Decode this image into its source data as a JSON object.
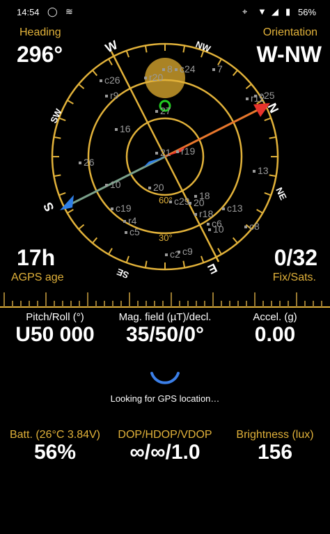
{
  "status_bar": {
    "time": "14:54",
    "battery_pct": "56%",
    "icons": [
      "whatsapp-icon",
      "signal-icon",
      "location-icon",
      "wifi-icon",
      "mobile-signal-icon",
      "battery-icon"
    ]
  },
  "top": {
    "heading_label": "Heading",
    "heading_value": "296°",
    "orientation_label": "Orientation",
    "orientation_value": "W-NW",
    "agps_value": "17h",
    "agps_label": "AGPS age",
    "fix_value": "0/32",
    "fix_label": "Fix/Sats."
  },
  "compass": {
    "directions": [
      "N",
      "NE",
      "E",
      "SE",
      "S",
      "SW",
      "W",
      "NW"
    ],
    "ring_labels": [
      "60°",
      "30°"
    ],
    "satellites": [
      {
        "id": "c26"
      },
      {
        "id": "8"
      },
      {
        "id": "c24"
      },
      {
        "id": "7"
      },
      {
        "id": "r20"
      },
      {
        "id": "r9"
      },
      {
        "id": "27"
      },
      {
        "id": "r12"
      },
      {
        "id": "c25"
      },
      {
        "id": "16"
      },
      {
        "id": "21"
      },
      {
        "id": "r19"
      },
      {
        "id": "26"
      },
      {
        "id": "13"
      },
      {
        "id": "10"
      },
      {
        "id": "20"
      },
      {
        "id": "18"
      },
      {
        "id": "c29"
      },
      {
        "id": "20"
      },
      {
        "id": "c19"
      },
      {
        "id": "c13"
      },
      {
        "id": "r18"
      },
      {
        "id": "r4"
      },
      {
        "id": "c6"
      },
      {
        "id": "c8"
      },
      {
        "id": "10"
      },
      {
        "id": "c5"
      },
      {
        "id": "c2"
      },
      {
        "id": "c9"
      }
    ],
    "colors": {
      "ring": "#e2b23a",
      "north": "#e8342c",
      "south": "#2f7fe6",
      "sun": "#c89a2a",
      "fix": "#22cc22"
    }
  },
  "stats_row1": {
    "pitch_label": "Pitch/Roll (°)",
    "pitch_value": "U50 000",
    "mag_label": "Mag. field (µT)/decl.",
    "mag_value": "35/50/0°",
    "accel_label": "Accel. (g)",
    "accel_value": "0.00"
  },
  "gps": {
    "status": "Looking for GPS location…"
  },
  "stats_row2": {
    "batt_label": "Batt. (26°C 3.84V)",
    "batt_value": "56%",
    "dop_label": "DOP/HDOP/VDOP",
    "dop_value": "∞/∞/1.0",
    "bright_label": "Brightness (lux)",
    "bright_value": "156"
  }
}
